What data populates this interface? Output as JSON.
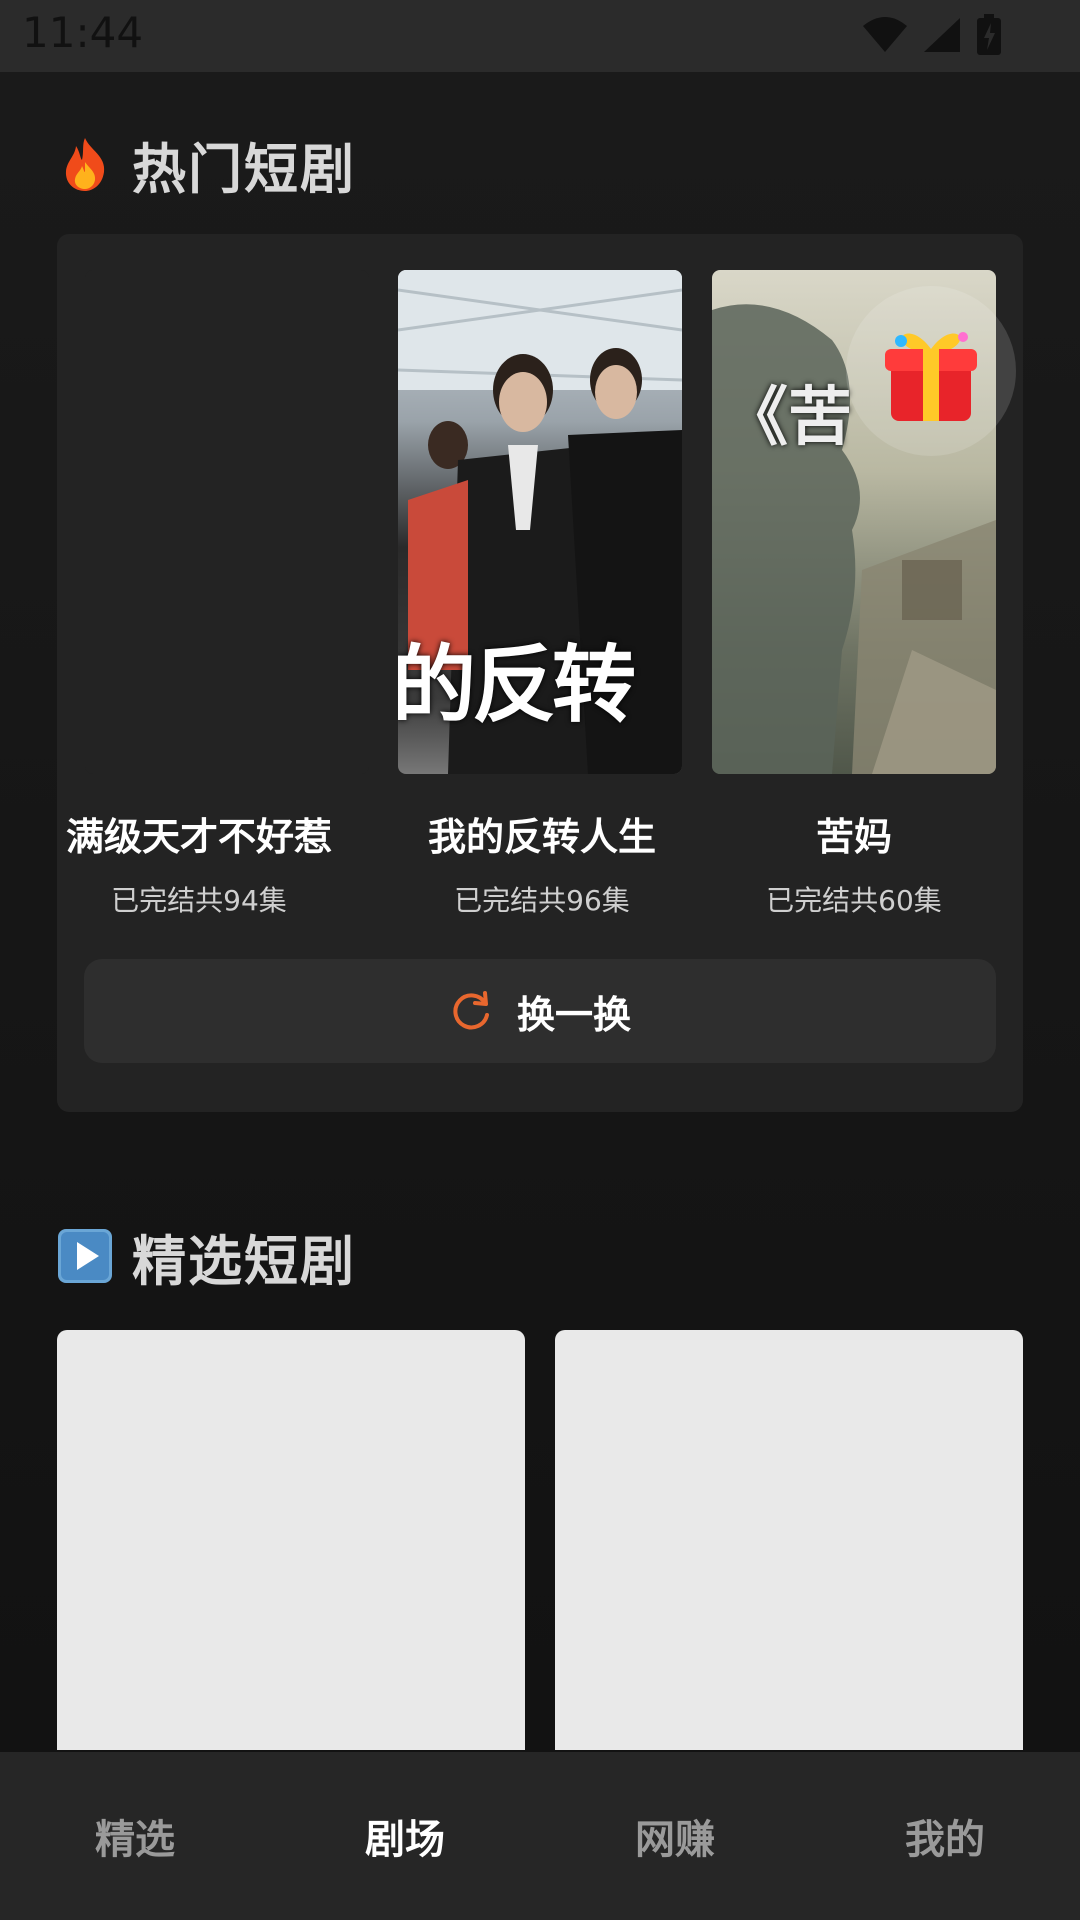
{
  "status_bar": {
    "time": "11:44"
  },
  "hot_section": {
    "title": "热门短剧",
    "dramas": [
      {
        "title": "满级天才不好惹",
        "subtitle": "已完结共94集"
      },
      {
        "title": "我的反转人生",
        "subtitle": "已完结共96集",
        "poster_text": "的反转"
      },
      {
        "title": "苦妈",
        "subtitle": "已完结共60集",
        "poster_text": "《苦"
      }
    ],
    "refresh_label": "换一换"
  },
  "featured_section": {
    "title": "精选短剧"
  },
  "bottom_nav": {
    "items": [
      {
        "label": "精选"
      },
      {
        "label": "剧场"
      },
      {
        "label": "网赚"
      },
      {
        "label": "我的"
      }
    ],
    "active_index": 1
  },
  "colors": {
    "accent": "#e8672e",
    "background": "#141414",
    "card": "#232323"
  },
  "icons": [
    "fire-icon",
    "play-icon",
    "refresh-icon",
    "gift-box-icon",
    "wifi-icon",
    "signal-icon",
    "battery-icon"
  ]
}
